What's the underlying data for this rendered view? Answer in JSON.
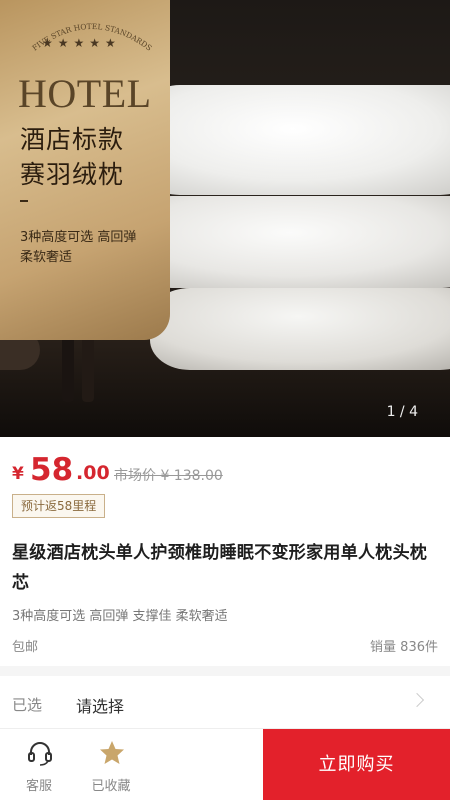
{
  "hero": {
    "badge_text": "FIVE STAR HOTEL STANDARDS",
    "stars": "★★★★★",
    "hotel_word": "HOTEL",
    "title_line1": "酒店标款",
    "title_line2": "赛羽绒枕",
    "dash": "-",
    "sub_line1": "3种高度可选 高回弹",
    "sub_line2": "柔软奢适",
    "indicator": "1 / 4"
  },
  "price": {
    "currency": "¥",
    "integer": "58",
    "decimal": ".00",
    "market_price": "市场价 ¥ 138.00",
    "mileage_tag": "预计返58里程"
  },
  "product": {
    "title": "星级酒店枕头单人护颈椎助睡眠不变形家用单人枕头枕芯",
    "tags": "3种高度可选 高回弹 支撑佳 柔软奢适",
    "shipping": "包邮",
    "sales": "销量 836件"
  },
  "spec": {
    "label": "已选",
    "value": "请选择"
  },
  "bottom_bar": {
    "service_label": "客服",
    "favorite_label": "已收藏",
    "buy_label": "立即购买"
  },
  "colors": {
    "accent_red": "#e3212b",
    "price_red": "#d5262f",
    "gold": "#c6a371",
    "favorite_star": "#c9a66b"
  },
  "icons": {
    "service": "headset-icon",
    "favorite": "star-icon",
    "chevron": "chevron-right-icon"
  }
}
